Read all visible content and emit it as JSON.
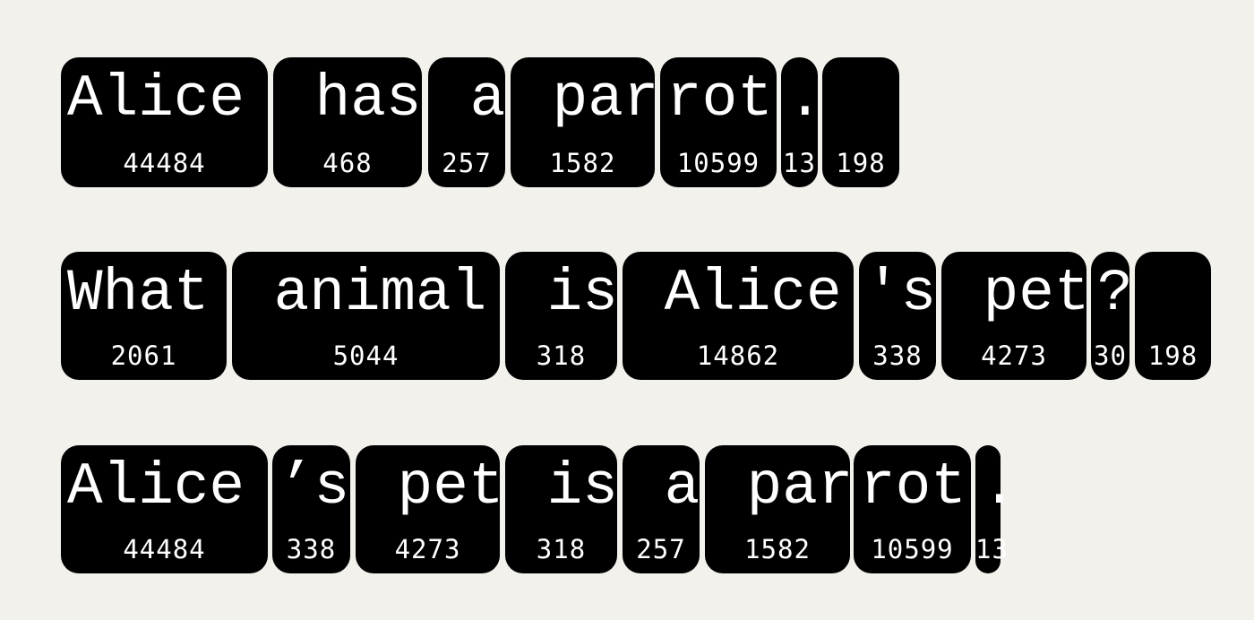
{
  "rows": [
    {
      "tokens": [
        {
          "text": "Alice",
          "id": "44484"
        },
        {
          "text": " has",
          "id": "468"
        },
        {
          "text": " a",
          "id": "257"
        },
        {
          "text": " par",
          "id": "1582"
        },
        {
          "text": "rot",
          "id": "10599"
        },
        {
          "text": ".",
          "id": "13"
        },
        {
          "text": "",
          "id": "198"
        }
      ]
    },
    {
      "tokens": [
        {
          "text": "What",
          "id": "2061"
        },
        {
          "text": " animal",
          "id": "5044"
        },
        {
          "text": " is",
          "id": "318"
        },
        {
          "text": " Alice",
          "id": "14862"
        },
        {
          "text": "'s",
          "id": "338"
        },
        {
          "text": " pet",
          "id": "4273"
        },
        {
          "text": "?",
          "id": "30"
        },
        {
          "text": "",
          "id": "198"
        }
      ]
    },
    {
      "tokens": [
        {
          "text": "Alice",
          "id": "44484"
        },
        {
          "text": "’s",
          "id": "338"
        },
        {
          "text": " pet",
          "id": "4273"
        },
        {
          "text": " is",
          "id": "318"
        },
        {
          "text": " a",
          "id": "257"
        },
        {
          "text": " par",
          "id": "1582"
        },
        {
          "text": "rot",
          "id": "10599"
        },
        {
          "text": ".",
          "id": "13"
        }
      ]
    }
  ]
}
